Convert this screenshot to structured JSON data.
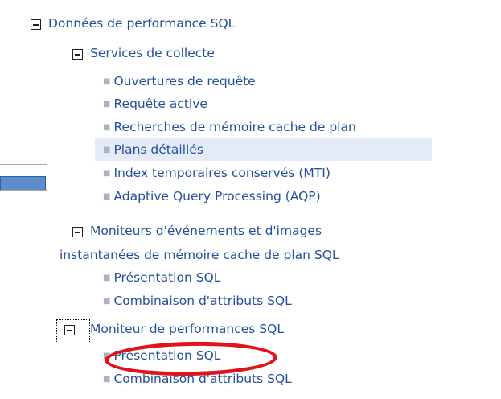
{
  "tree": {
    "root": {
      "label": "Données de performance SQL"
    },
    "services": {
      "label": "Services de collecte",
      "items": [
        "Ouvertures de requête",
        "Requête active",
        "Recherches de mémoire cache de plan",
        "Plans détaillés",
        "Index temporaires conservés (MTI)",
        "Adaptive Query Processing (AQP)"
      ]
    },
    "monitors": {
      "label_line1": "Moniteurs d'événements et d'images",
      "label_line2": "instantanées de mémoire cache de plan SQL",
      "items": [
        "Présentation SQL",
        "Combinaison d'attributs SQL"
      ]
    },
    "perf_monitor": {
      "label": "Moniteur de performances SQL",
      "items": [
        "Présentation SQL",
        "Combinaison d'attributs SQL"
      ]
    }
  },
  "colors": {
    "link": "#23509e",
    "selected_row": "#e6ecf7",
    "annotation": "#e0141c"
  },
  "icons": {
    "collapse": "minus-box-icon",
    "bullet": "square-bullet-icon"
  }
}
